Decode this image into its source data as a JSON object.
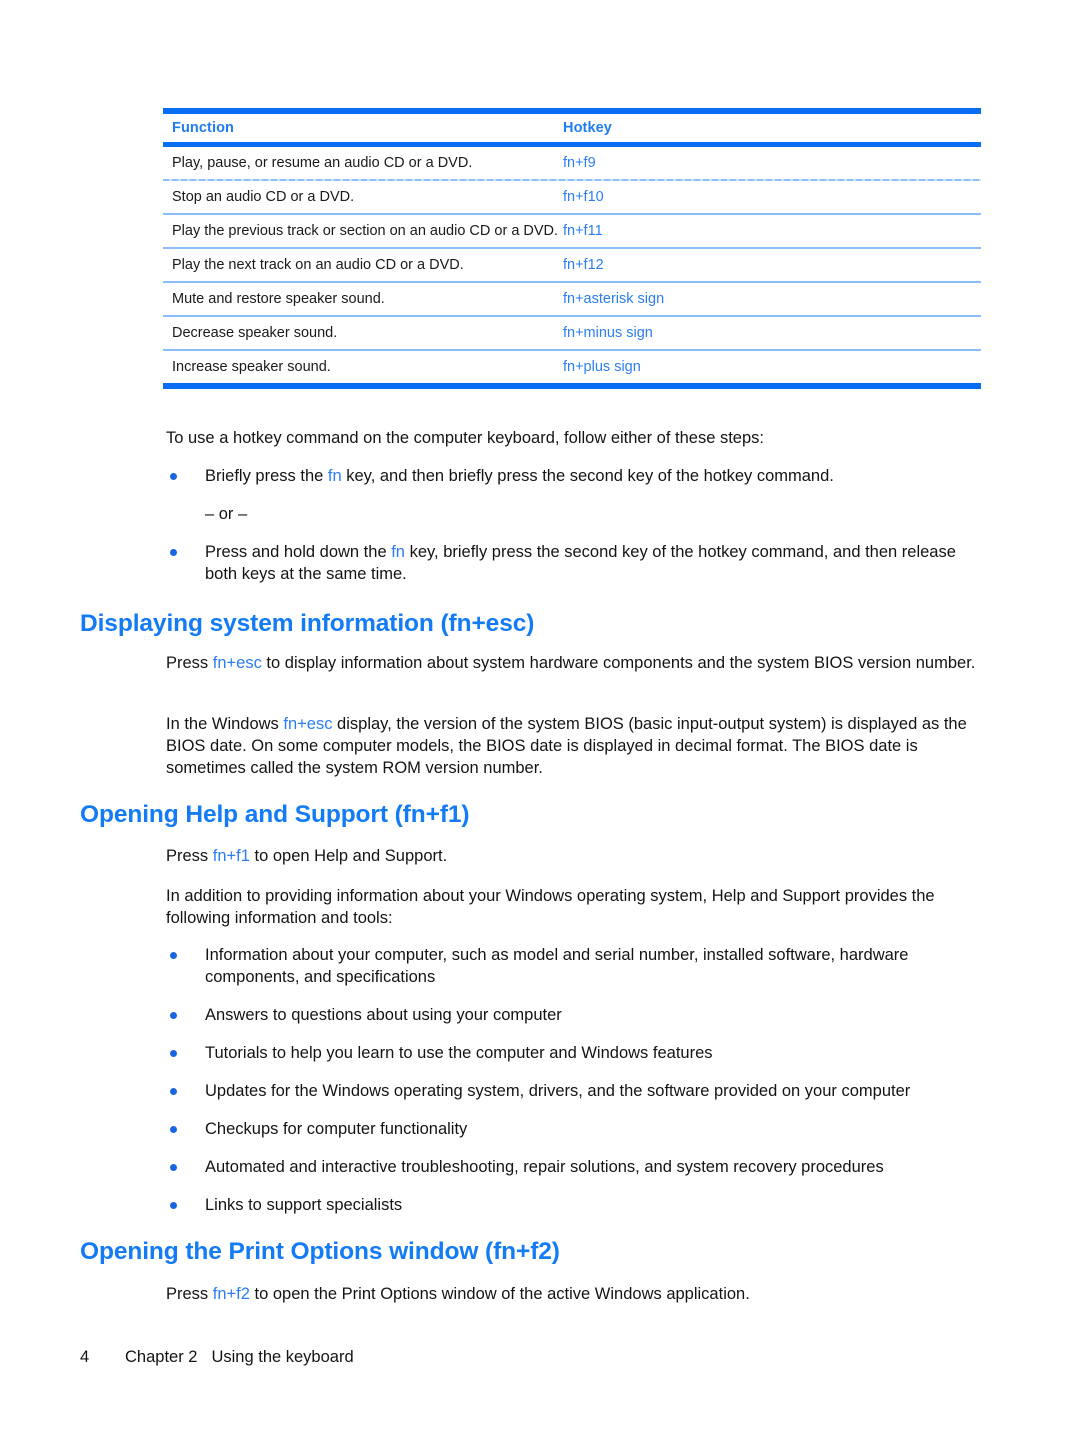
{
  "table": {
    "headers": [
      "Function",
      "Hotkey"
    ],
    "rows": [
      {
        "function": "Play, pause, or resume an audio CD or a DVD.",
        "hotkey": "fn+f9"
      },
      {
        "function": "Stop an audio CD or a DVD.",
        "hotkey": "fn+f10"
      },
      {
        "function": "Play the previous track or section on an audio CD or a DVD.",
        "hotkey": "fn+f11"
      },
      {
        "function": "Play the next track on an audio CD or a DVD.",
        "hotkey": "fn+f12"
      },
      {
        "function": "Mute and restore speaker sound.",
        "hotkey": "fn+asterisk sign"
      },
      {
        "function": "Decrease speaker sound.",
        "hotkey": "fn+minus sign"
      },
      {
        "function": "Increase speaker sound.",
        "hotkey": "fn+plus sign"
      }
    ]
  },
  "intro": {
    "lead": "To use a hotkey command on the computer keyboard, follow either of these steps:",
    "bullet1_a": "Briefly press the ",
    "bullet1_key": "fn",
    "bullet1_b": " key, and then briefly press the second key of the hotkey command.",
    "or_text": "– or –",
    "bullet2_a": "Press and hold down the ",
    "bullet2_key": "fn",
    "bullet2_b": " key, briefly press the second key of the hotkey command, and then release both keys at the same time."
  },
  "section_sysinfo": {
    "heading": "Displaying system information (fn+esc)",
    "p1_a": "Press ",
    "p1_key": "fn+esc",
    "p1_b": " to display information about system hardware components and the system BIOS version number.",
    "p2_a": "In the Windows ",
    "p2_key": "fn+esc",
    "p2_b": " display, the version of the system BIOS (basic input-output system) is displayed as the BIOS date. On some computer models, the BIOS date is displayed in decimal format. The BIOS date is sometimes called the system ROM version number."
  },
  "section_help": {
    "heading": "Opening Help and Support (fn+f1)",
    "p1_a": "Press ",
    "p1_key": "fn+f1",
    "p1_b": " to open Help and Support.",
    "p2": "In addition to providing information about your Windows operating system, Help and Support provides the following information and tools:",
    "bullets": [
      "Information about your computer, such as model and serial number, installed software, hardware components, and specifications",
      "Answers to questions about using your computer",
      "Tutorials to help you learn to use the computer and Windows features",
      "Updates for the Windows operating system, drivers, and the software provided on your computer",
      "Checkups for computer functionality",
      "Automated and interactive troubleshooting, repair solutions, and system recovery procedures",
      "Links to support specialists"
    ]
  },
  "section_print": {
    "heading": "Opening the Print Options window (fn+f2)",
    "p1_a": "Press ",
    "p1_key": "fn+f2",
    "p1_b": " to open the Print Options window of the active Windows application."
  },
  "footer": {
    "page_number": "4",
    "chapter": "Chapter 2",
    "chapter_title": "Using the keyboard"
  },
  "colors": {
    "accent_blue": "#127bf5",
    "rule_blue": "#0a6ef5",
    "rule_light_blue": "#8cbdfb",
    "key_blue": "#2b7ef4",
    "bullet_blue": "#1a66e0",
    "text_black": "#141414"
  }
}
